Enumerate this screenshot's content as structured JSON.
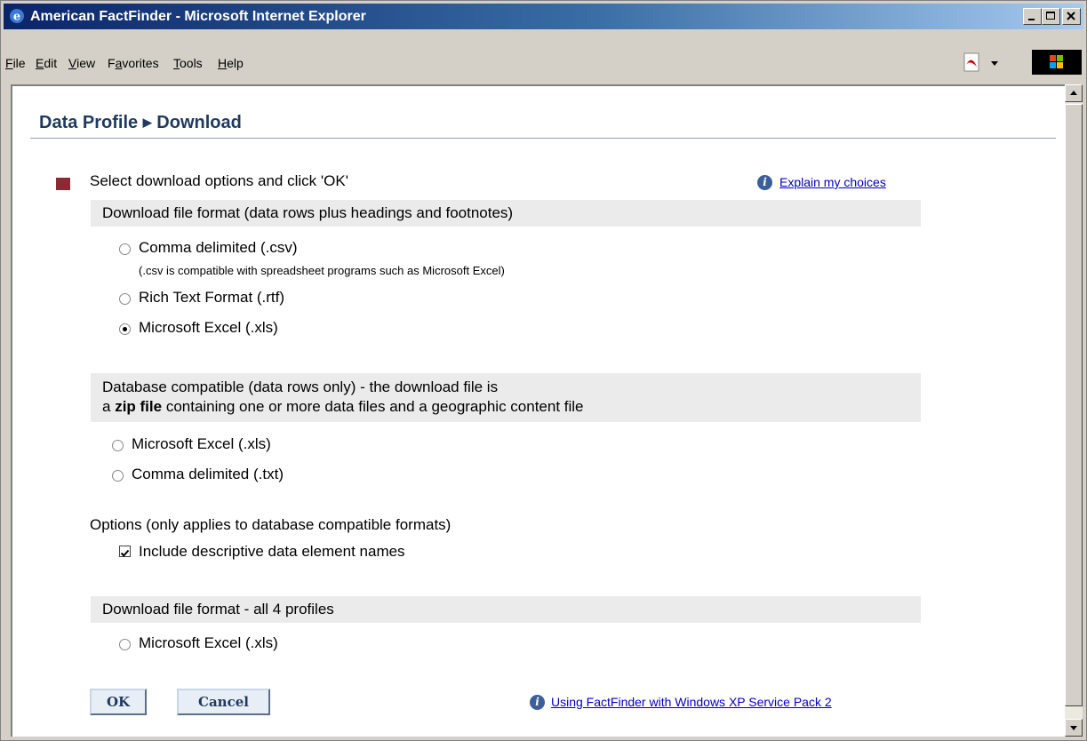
{
  "window": {
    "title": "American FactFinder - Microsoft Internet Explorer"
  },
  "menu": {
    "items": [
      {
        "label": "File"
      },
      {
        "label": "Edit"
      },
      {
        "label": "View"
      },
      {
        "label": "Favorites"
      },
      {
        "label": "Tools"
      },
      {
        "label": "Help"
      }
    ]
  },
  "page": {
    "breadcrumb_part1": "Data Profile",
    "breadcrumb_sep": "▶",
    "breadcrumb_part2": "Download",
    "instruction": "Select download options and click 'OK'",
    "explain_link": "Explain my choices",
    "section1": {
      "header": "Download file format (data rows plus headings and footnotes)",
      "options": [
        {
          "label": "Comma delimited (.csv)",
          "selected": false
        },
        {
          "label": "Rich Text Format (.rtf)",
          "selected": false
        },
        {
          "label": "Microsoft Excel (.xls)",
          "selected": true
        }
      ],
      "csv_note": "(.csv is compatible with spreadsheet programs such as Microsoft Excel)"
    },
    "section2": {
      "header_line1": "Database compatible (data rows only) - the download file is",
      "header_line2_pre": "a ",
      "header_line2_bold": "zip file",
      "header_line2_post": " containing one or more data files and a geographic content file",
      "options": [
        {
          "label": "Microsoft Excel (.xls)",
          "selected": false
        },
        {
          "label": "Comma delimited (.txt)",
          "selected": false
        }
      ]
    },
    "options_section": {
      "header": "Options (only applies to database compatible formats)",
      "checkbox_label": "Include descriptive data element names",
      "checked": true
    },
    "section3": {
      "header": "Download file format - all 4 profiles",
      "options": [
        {
          "label": "Microsoft Excel (.xls)",
          "selected": false
        }
      ]
    },
    "ok_label": "OK",
    "cancel_label": "Cancel",
    "xp_link": "Using FactFinder with Windows XP Service Pack 2"
  },
  "colors": {
    "heading": "#1f3a5f",
    "bullet": "#8b2a35",
    "link": "#0000cc",
    "band": "#ebebeb"
  },
  "icons": [
    "ie-icon",
    "minimize-icon",
    "maximize-icon",
    "close-icon",
    "pdf-icon",
    "windows-logo-icon",
    "info-icon",
    "checkmark-icon"
  ]
}
